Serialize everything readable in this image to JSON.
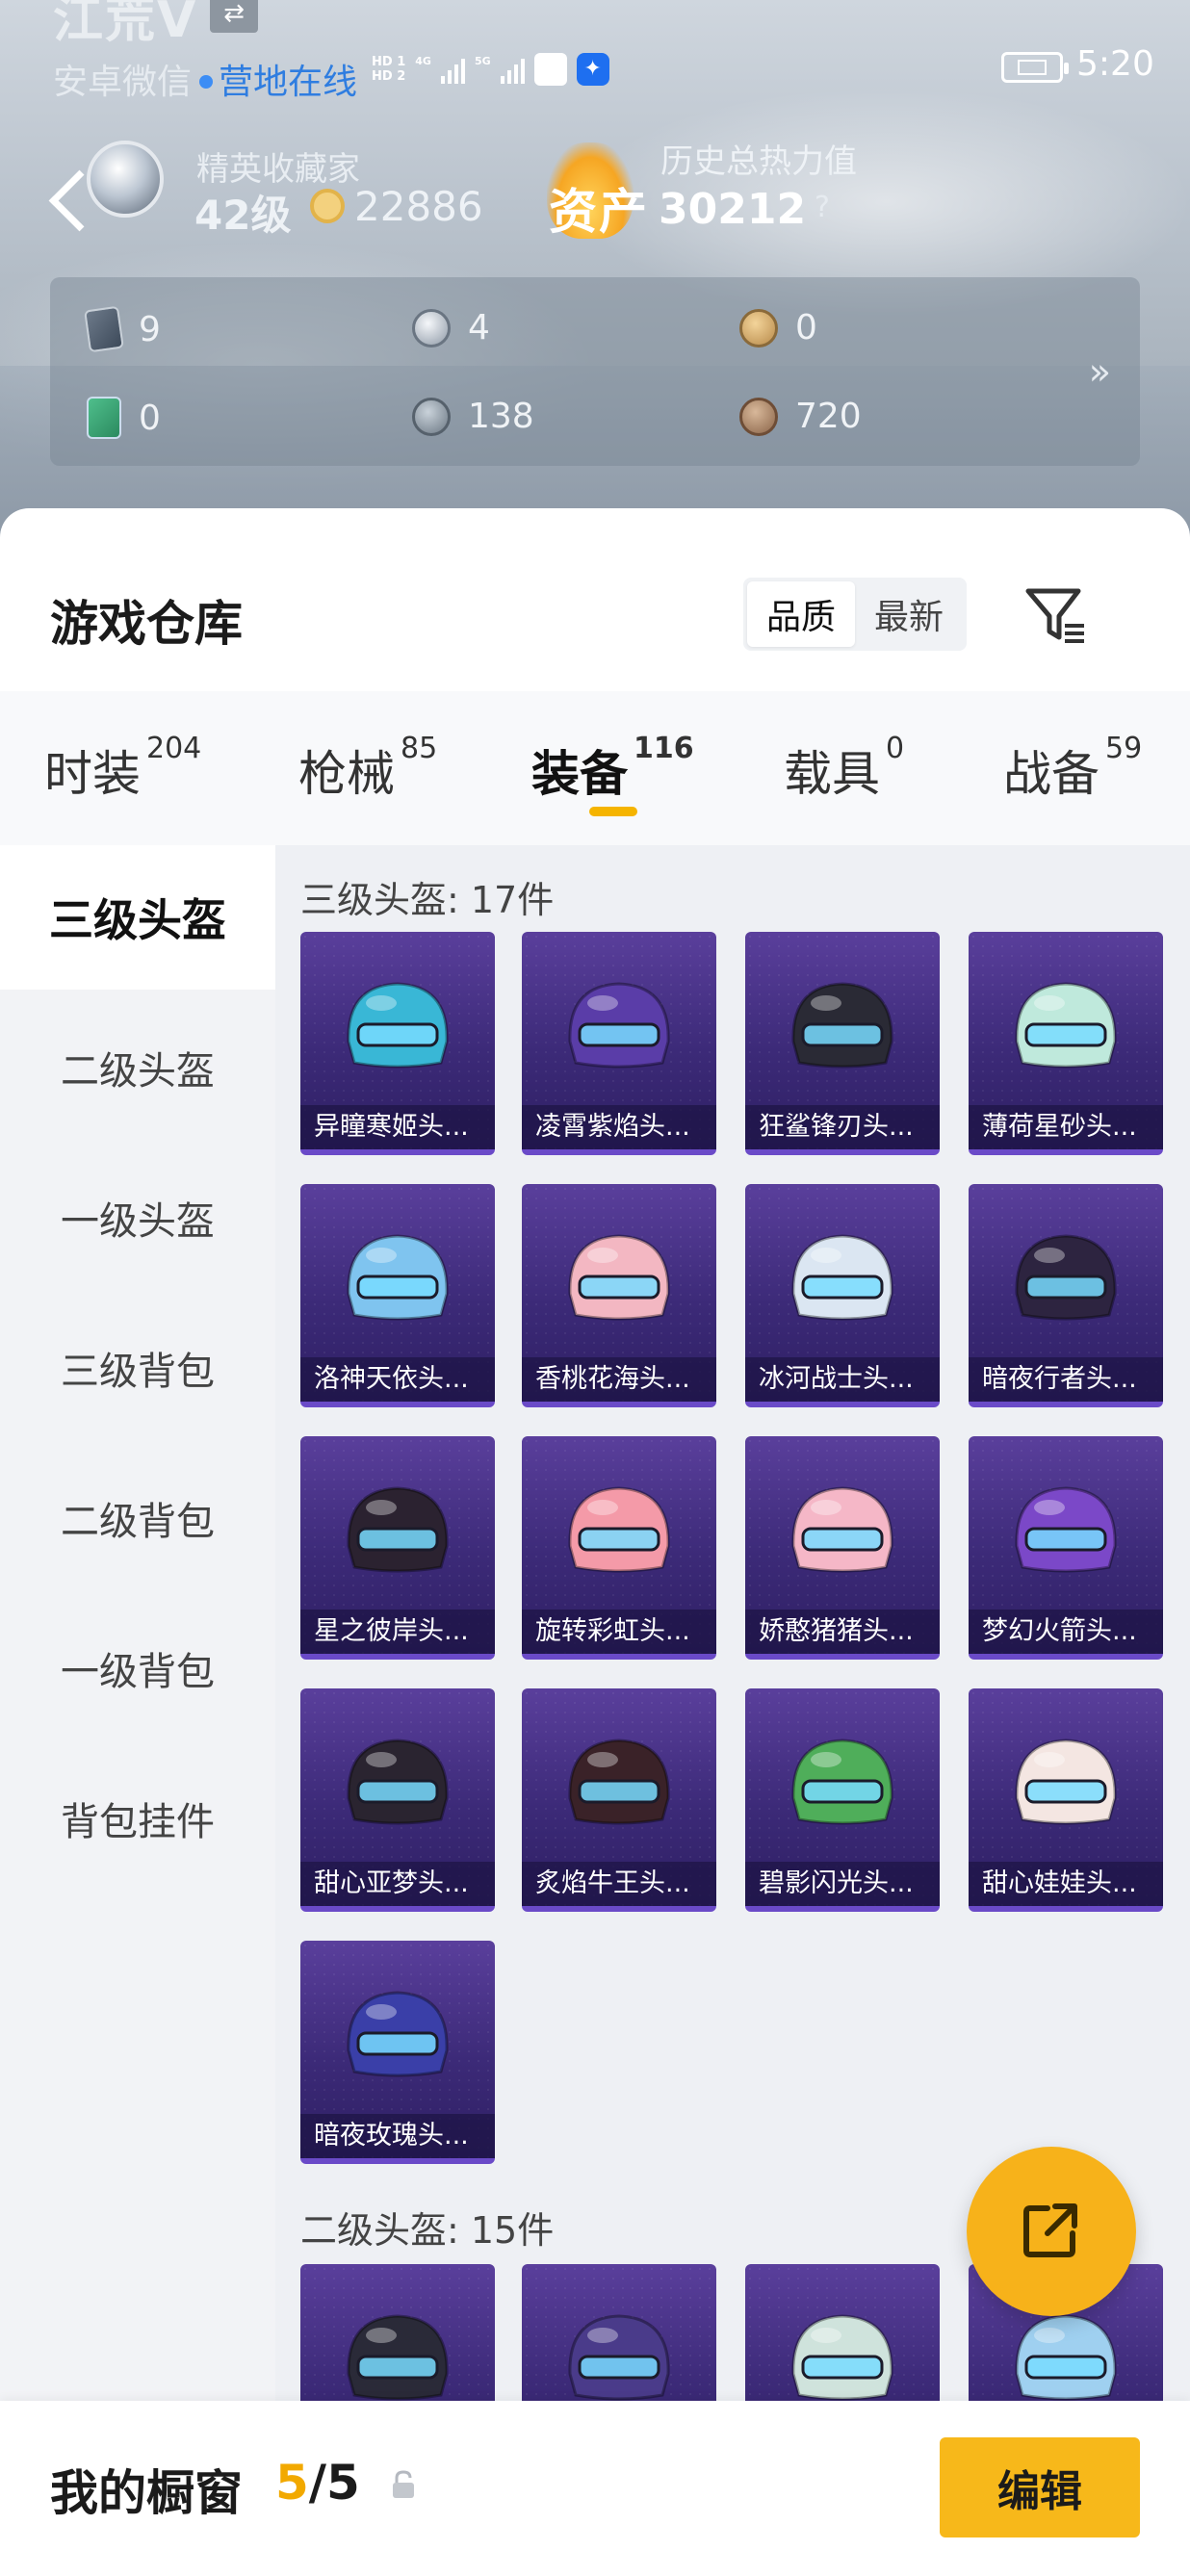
{
  "status_bar": {
    "player_name": "江荒V",
    "account_line": "安卓微信",
    "online_text": "营地在线",
    "hd1": "HD 1",
    "hd2": "HD 2",
    "net1": "4G",
    "net2": "5G",
    "time": "5:20"
  },
  "profile": {
    "elite_title": "精英收藏家",
    "elite_level": "42级",
    "coin_value": "22886",
    "asset_label": "资产",
    "history_title": "历史总热力值",
    "history_value": "30212",
    "help_mark": "?"
  },
  "stats": [
    {
      "icon": "card-icon",
      "value": "9"
    },
    {
      "icon": "silver-token-icon",
      "value": "4"
    },
    {
      "icon": "gold-token-icon",
      "value": "0"
    },
    {
      "icon": "green-card-icon",
      "value": "0"
    },
    {
      "icon": "grey-coin-icon",
      "value": "138"
    },
    {
      "icon": "bronze-coin-icon",
      "value": "720"
    }
  ],
  "more_arrow": "»",
  "warehouse": {
    "title": "游戏仓库",
    "sort_options": [
      "品质",
      "最新"
    ],
    "sort_selected": "品质"
  },
  "tabs": [
    {
      "label": "时装",
      "count": "204"
    },
    {
      "label": "枪械",
      "count": "85"
    },
    {
      "label": "装备",
      "count": "116",
      "active": true
    },
    {
      "label": "载具",
      "count": "0"
    },
    {
      "label": "战备",
      "count": "59"
    }
  ],
  "sidebar": [
    {
      "label": "三级头盔",
      "active": true
    },
    {
      "label": "二级头盔"
    },
    {
      "label": "一级头盔"
    },
    {
      "label": "三级背包"
    },
    {
      "label": "二级背包"
    },
    {
      "label": "一级背包"
    },
    {
      "label": "背包挂件"
    }
  ],
  "sections": [
    {
      "title": "三级头盔: 17件",
      "items": [
        {
          "name": "异瞳寒姬头...",
          "color": "#39b7d6"
        },
        {
          "name": "凌霄紫焰头...",
          "color": "#5a3da8"
        },
        {
          "name": "狂鲨锋刃头...",
          "color": "#2a2a35"
        },
        {
          "name": "薄荷星砂头...",
          "color": "#bfe9dc"
        },
        {
          "name": "洛神天依头...",
          "color": "#7fc4ef"
        },
        {
          "name": "香桃花海头...",
          "color": "#f3b7c2"
        },
        {
          "name": "冰河战士头...",
          "color": "#dbe6f2"
        },
        {
          "name": "暗夜行者头...",
          "color": "#2d2440"
        },
        {
          "name": "星之彼岸头...",
          "color": "#2b2230"
        },
        {
          "name": "旋转彩虹头...",
          "color": "#f49aa8"
        },
        {
          "name": "娇憨猪猪头...",
          "color": "#f5b7c7"
        },
        {
          "name": "梦幻火箭头...",
          "color": "#7b48c8"
        },
        {
          "name": "甜心亚梦头...",
          "color": "#2a2430"
        },
        {
          "name": "炙焰牛王头...",
          "color": "#3a2228"
        },
        {
          "name": "碧影闪光头...",
          "color": "#4fae5a"
        },
        {
          "name": "甜心娃娃头...",
          "color": "#f4e6e2"
        },
        {
          "name": "暗夜玫瑰头...",
          "color": "#3a3fa8"
        }
      ]
    },
    {
      "title": "二级头盔: 15件",
      "items": [
        {
          "name": "",
          "color": "#2a2a38"
        },
        {
          "name": "",
          "color": "#4a3b8a"
        },
        {
          "name": "",
          "color": "#cfe3dc"
        },
        {
          "name": "",
          "color": "#9fd0f0"
        }
      ]
    }
  ],
  "bottom_bar": {
    "label": "我的橱窗",
    "current": "5",
    "total": "/5",
    "edit_label": "编辑"
  }
}
